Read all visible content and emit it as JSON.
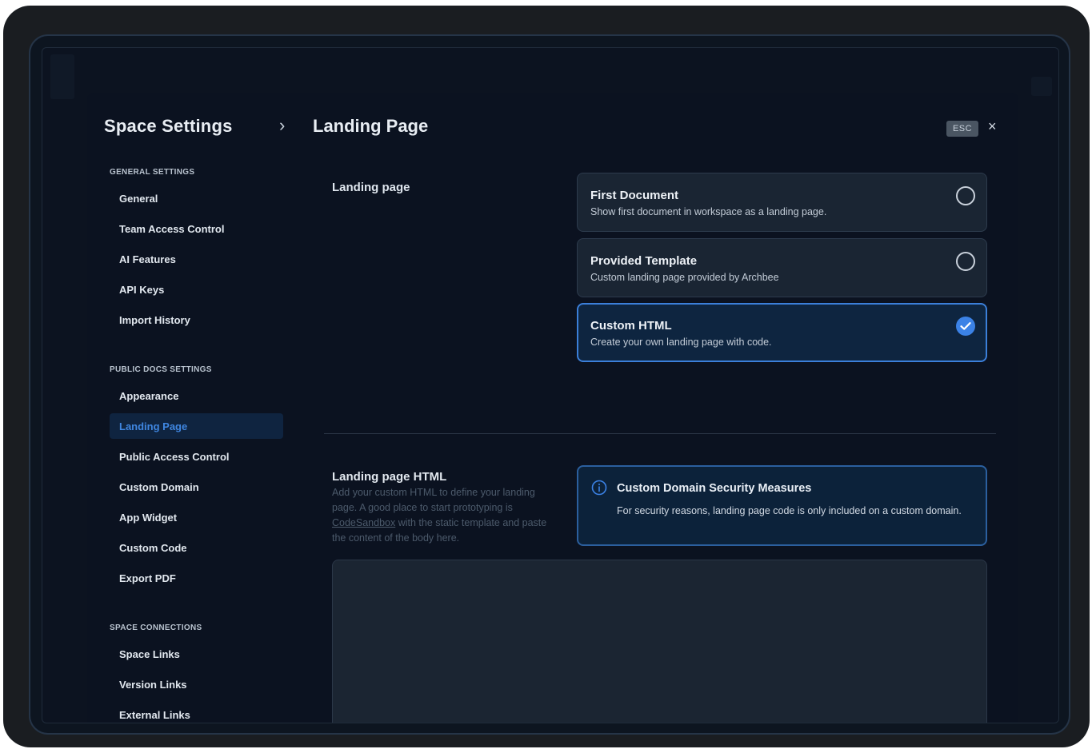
{
  "header": {
    "breadcrumb_root": "Space Settings",
    "breadcrumb_separator": "›",
    "breadcrumb_current": "Landing Page",
    "esc_label": "ESC",
    "close_glyph": "×"
  },
  "sidebar": {
    "general": {
      "heading": "GENERAL SETTINGS",
      "items": [
        "General",
        "Team Access Control",
        "AI Features",
        "API Keys",
        "Import History"
      ]
    },
    "public_docs": {
      "heading": "PUBLIC DOCS SETTINGS",
      "items": [
        "Appearance",
        "Landing Page",
        "Public Access Control",
        "Custom Domain",
        "App Widget",
        "Custom Code",
        "Export PDF"
      ],
      "active": "Landing Page"
    },
    "connections": {
      "heading": "SPACE CONNECTIONS",
      "items": [
        "Space Links",
        "Version Links",
        "External Links"
      ]
    }
  },
  "landing": {
    "label": "Landing page",
    "options": [
      {
        "title": "First Document",
        "description": "Show first document in workspace as a landing page.",
        "selected": false
      },
      {
        "title": "Provided Template",
        "description": "Custom landing page provided by Archbee",
        "selected": false
      },
      {
        "title": "Custom HTML",
        "description": "Create your own landing page with code.",
        "selected": true
      }
    ]
  },
  "html_section": {
    "title": "Landing page HTML",
    "desc_before": "Add your custom HTML to define your landing page. A good place to start prototyping is ",
    "desc_link": "CodeSandbox",
    "desc_after": " with the static template and paste the content of the body here."
  },
  "info": {
    "icon": "info-icon",
    "title": "Custom Domain Security Measures",
    "body": "For security reasons, landing page code is only included on a custom domain."
  },
  "colors": {
    "accent": "#3b82e6",
    "active_nav_text": "#3f86e0",
    "background": "#0b1220"
  }
}
